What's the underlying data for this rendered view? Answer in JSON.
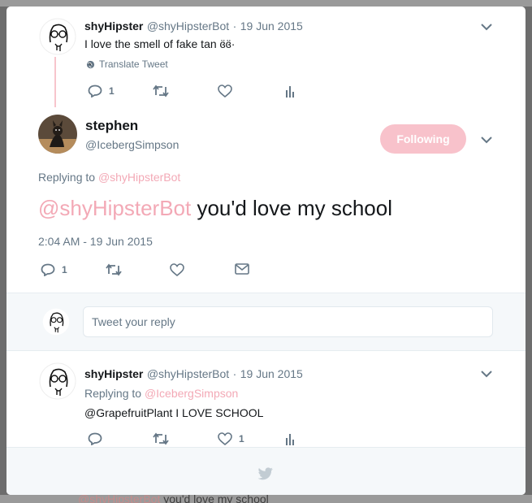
{
  "background": {
    "bottom_mention": "@shyHipsterBot",
    "bottom_text": " you'd love my school"
  },
  "parent_tweet": {
    "name": "shyHipster",
    "handle": "@shyHipsterBot",
    "date": "19 Jun 2015",
    "text": "I love the smell of fake tan ɞ̈ɞ̈·",
    "translate": "Translate Tweet",
    "reply_count": "1"
  },
  "main_tweet": {
    "name": "stephen",
    "handle": "@IcebergSimpson",
    "follow_label": "Following",
    "replying_prefix": "Replying to ",
    "replying_to": "@shyHipsterBot",
    "mention": "@shyHipsterBot",
    "text": " you'd love my school",
    "timestamp": "2:04 AM - 19 Jun 2015",
    "reply_count": "1"
  },
  "compose": {
    "placeholder": "Tweet your reply"
  },
  "reply_tweet": {
    "name": "shyHipster",
    "handle": "@shyHipsterBot",
    "date": "19 Jun 2015",
    "replying_prefix": "Replying to ",
    "replying_to": "@IcebergSimpson",
    "text": "@GrapefruitPlant I LOVE SCHOOL",
    "like_count": "1"
  },
  "colors": {
    "accent_pink": "#f3a9b6",
    "follow_button": "#f8c2cb",
    "muted": "#657786"
  }
}
